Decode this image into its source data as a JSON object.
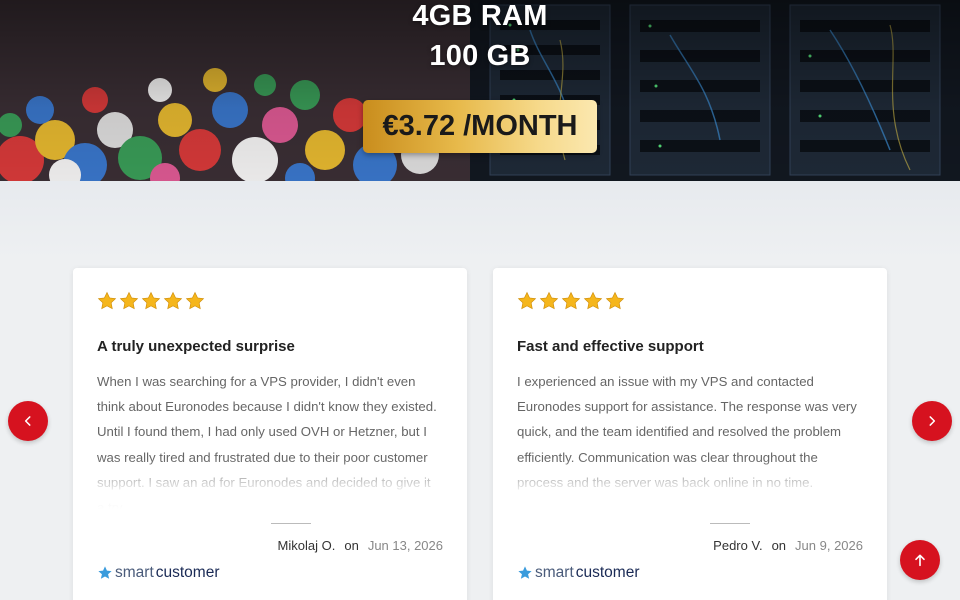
{
  "hero": {
    "ram": "4GB RAM",
    "disk": "100 GB",
    "price": "€3.72 /MONTH"
  },
  "colors": {
    "accent_red": "#d6121f",
    "price_gold": "#e7b94a",
    "star_gold": "#f5b61c"
  },
  "reviews": [
    {
      "rating": 5,
      "title": "A truly unexpected surprise",
      "body": "When I was searching for a VPS provider, I didn't even think about Euronodes because I didn't know they existed. Until I found them, I had only used OVH or Hetzner, but I was really tired and frustrated due to their poor customer support. I saw an ad for Euronodes and decided to give it a try...",
      "author": "Mikolaj O.",
      "on": "on",
      "date": "Jun 13, 2026",
      "source_smart": "smart",
      "source_customer": "customer"
    },
    {
      "rating": 5,
      "title": "Fast and effective support",
      "body": "I experienced an issue with my VPS and contacted Euronodes support for assistance. The response was very quick, and the team identified and resolved the problem efficiently. Communication was clear throughout the process and the server was back online in no time.",
      "author": "Pedro V.",
      "on": "on",
      "date": "Jun 9, 2026",
      "source_smart": "smart",
      "source_customer": "customer"
    }
  ],
  "icons": {
    "prev": "chevron-left-icon",
    "next": "chevron-right-icon",
    "totop": "arrow-up-icon",
    "star": "star-icon"
  }
}
